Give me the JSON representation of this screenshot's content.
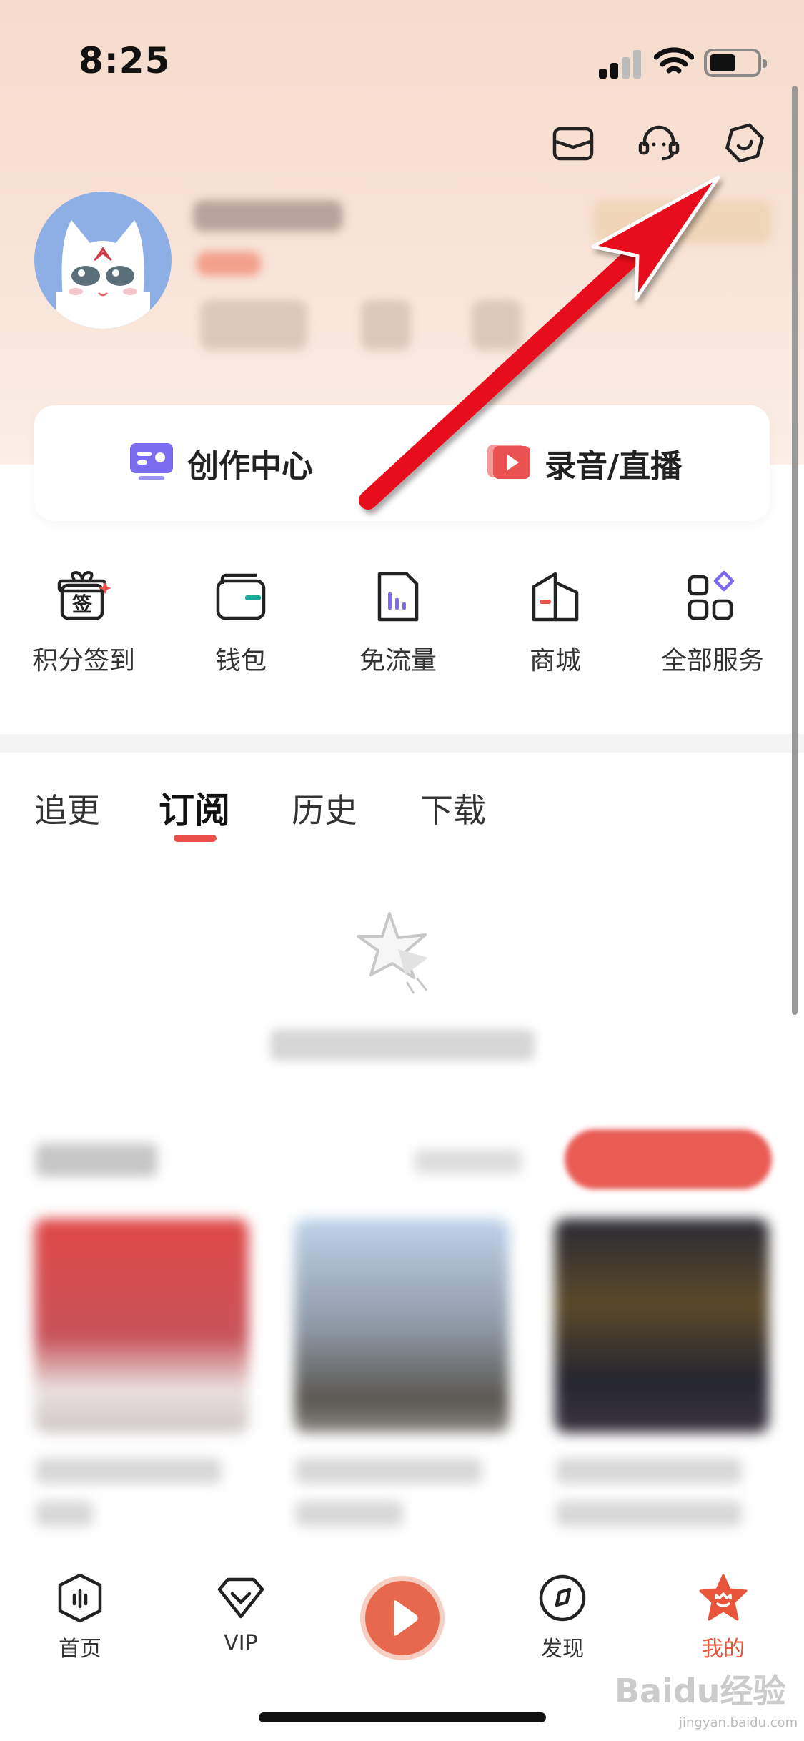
{
  "status_bar": {
    "time": "8:25"
  },
  "header_icons": [
    "mail-icon",
    "customer-service-icon",
    "settings-icon"
  ],
  "create_card": {
    "creation_center_label": "创作中心",
    "record_live_label": "录音/直播"
  },
  "services": [
    {
      "label": "积分签到",
      "icon": "checkin-gift-icon"
    },
    {
      "label": "钱包",
      "icon": "wallet-icon"
    },
    {
      "label": "免流量",
      "icon": "data-free-icon"
    },
    {
      "label": "商城",
      "icon": "shop-icon"
    },
    {
      "label": "全部服务",
      "icon": "all-services-icon"
    }
  ],
  "checkin_badge": "签",
  "tabs": [
    {
      "label": "追更",
      "active": false
    },
    {
      "label": "订阅",
      "active": true
    },
    {
      "label": "历史",
      "active": false
    },
    {
      "label": "下载",
      "active": false
    }
  ],
  "bottom_nav": [
    {
      "label": "首页",
      "icon": "home-icon"
    },
    {
      "label": "VIP",
      "icon": "vip-icon"
    },
    {
      "label": "",
      "icon": "play-icon"
    },
    {
      "label": "发现",
      "icon": "discover-icon"
    },
    {
      "label": "我的",
      "icon": "profile-star-icon",
      "active": true
    }
  ],
  "watermark": {
    "text": "Baidu经验",
    "sub": "jingyan.baidu.com"
  },
  "colors": {
    "accent": "#e8553a",
    "tab_underline": "#ea4f4a",
    "arrow": "#e8101a"
  }
}
